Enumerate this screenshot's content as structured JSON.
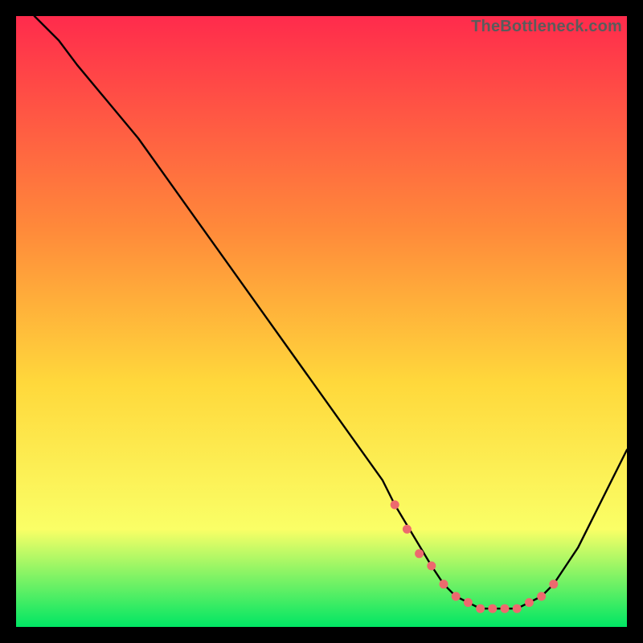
{
  "watermark": "TheBottleneck.com",
  "colors": {
    "gradient_top": "#ff2b4c",
    "gradient_mid1": "#ff8a3a",
    "gradient_mid2": "#ffd83b",
    "gradient_mid3": "#faff66",
    "gradient_bottom": "#00e664",
    "curve": "#000000",
    "marker": "#ed6a6e",
    "background": "#000000"
  },
  "chart_data": {
    "type": "line",
    "title": "",
    "xlabel": "",
    "ylabel": "",
    "xlim": [
      0,
      100
    ],
    "ylim": [
      0,
      100
    ],
    "grid": false,
    "legend": false,
    "series": [
      {
        "name": "bottleneck-curve",
        "x": [
          3,
          7,
          10,
          15,
          20,
          25,
          30,
          35,
          40,
          45,
          50,
          55,
          60,
          62,
          65,
          68,
          70,
          72,
          74,
          76,
          78,
          80,
          82,
          84,
          86,
          88,
          90,
          92,
          94,
          96,
          98,
          100
        ],
        "y": [
          100,
          96,
          92,
          86,
          80,
          73,
          66,
          59,
          52,
          45,
          38,
          31,
          24,
          20,
          15,
          10,
          7,
          5,
          4,
          3,
          3,
          3,
          3,
          4,
          5,
          7,
          10,
          13,
          17,
          21,
          25,
          29
        ]
      }
    ],
    "markers": {
      "name": "highlight-points",
      "x": [
        62,
        64,
        66,
        68,
        70,
        72,
        74,
        76,
        78,
        80,
        82,
        84,
        86,
        88
      ],
      "y": [
        20,
        16,
        12,
        10,
        7,
        5,
        4,
        3,
        3,
        3,
        3,
        4,
        5,
        7
      ]
    }
  }
}
